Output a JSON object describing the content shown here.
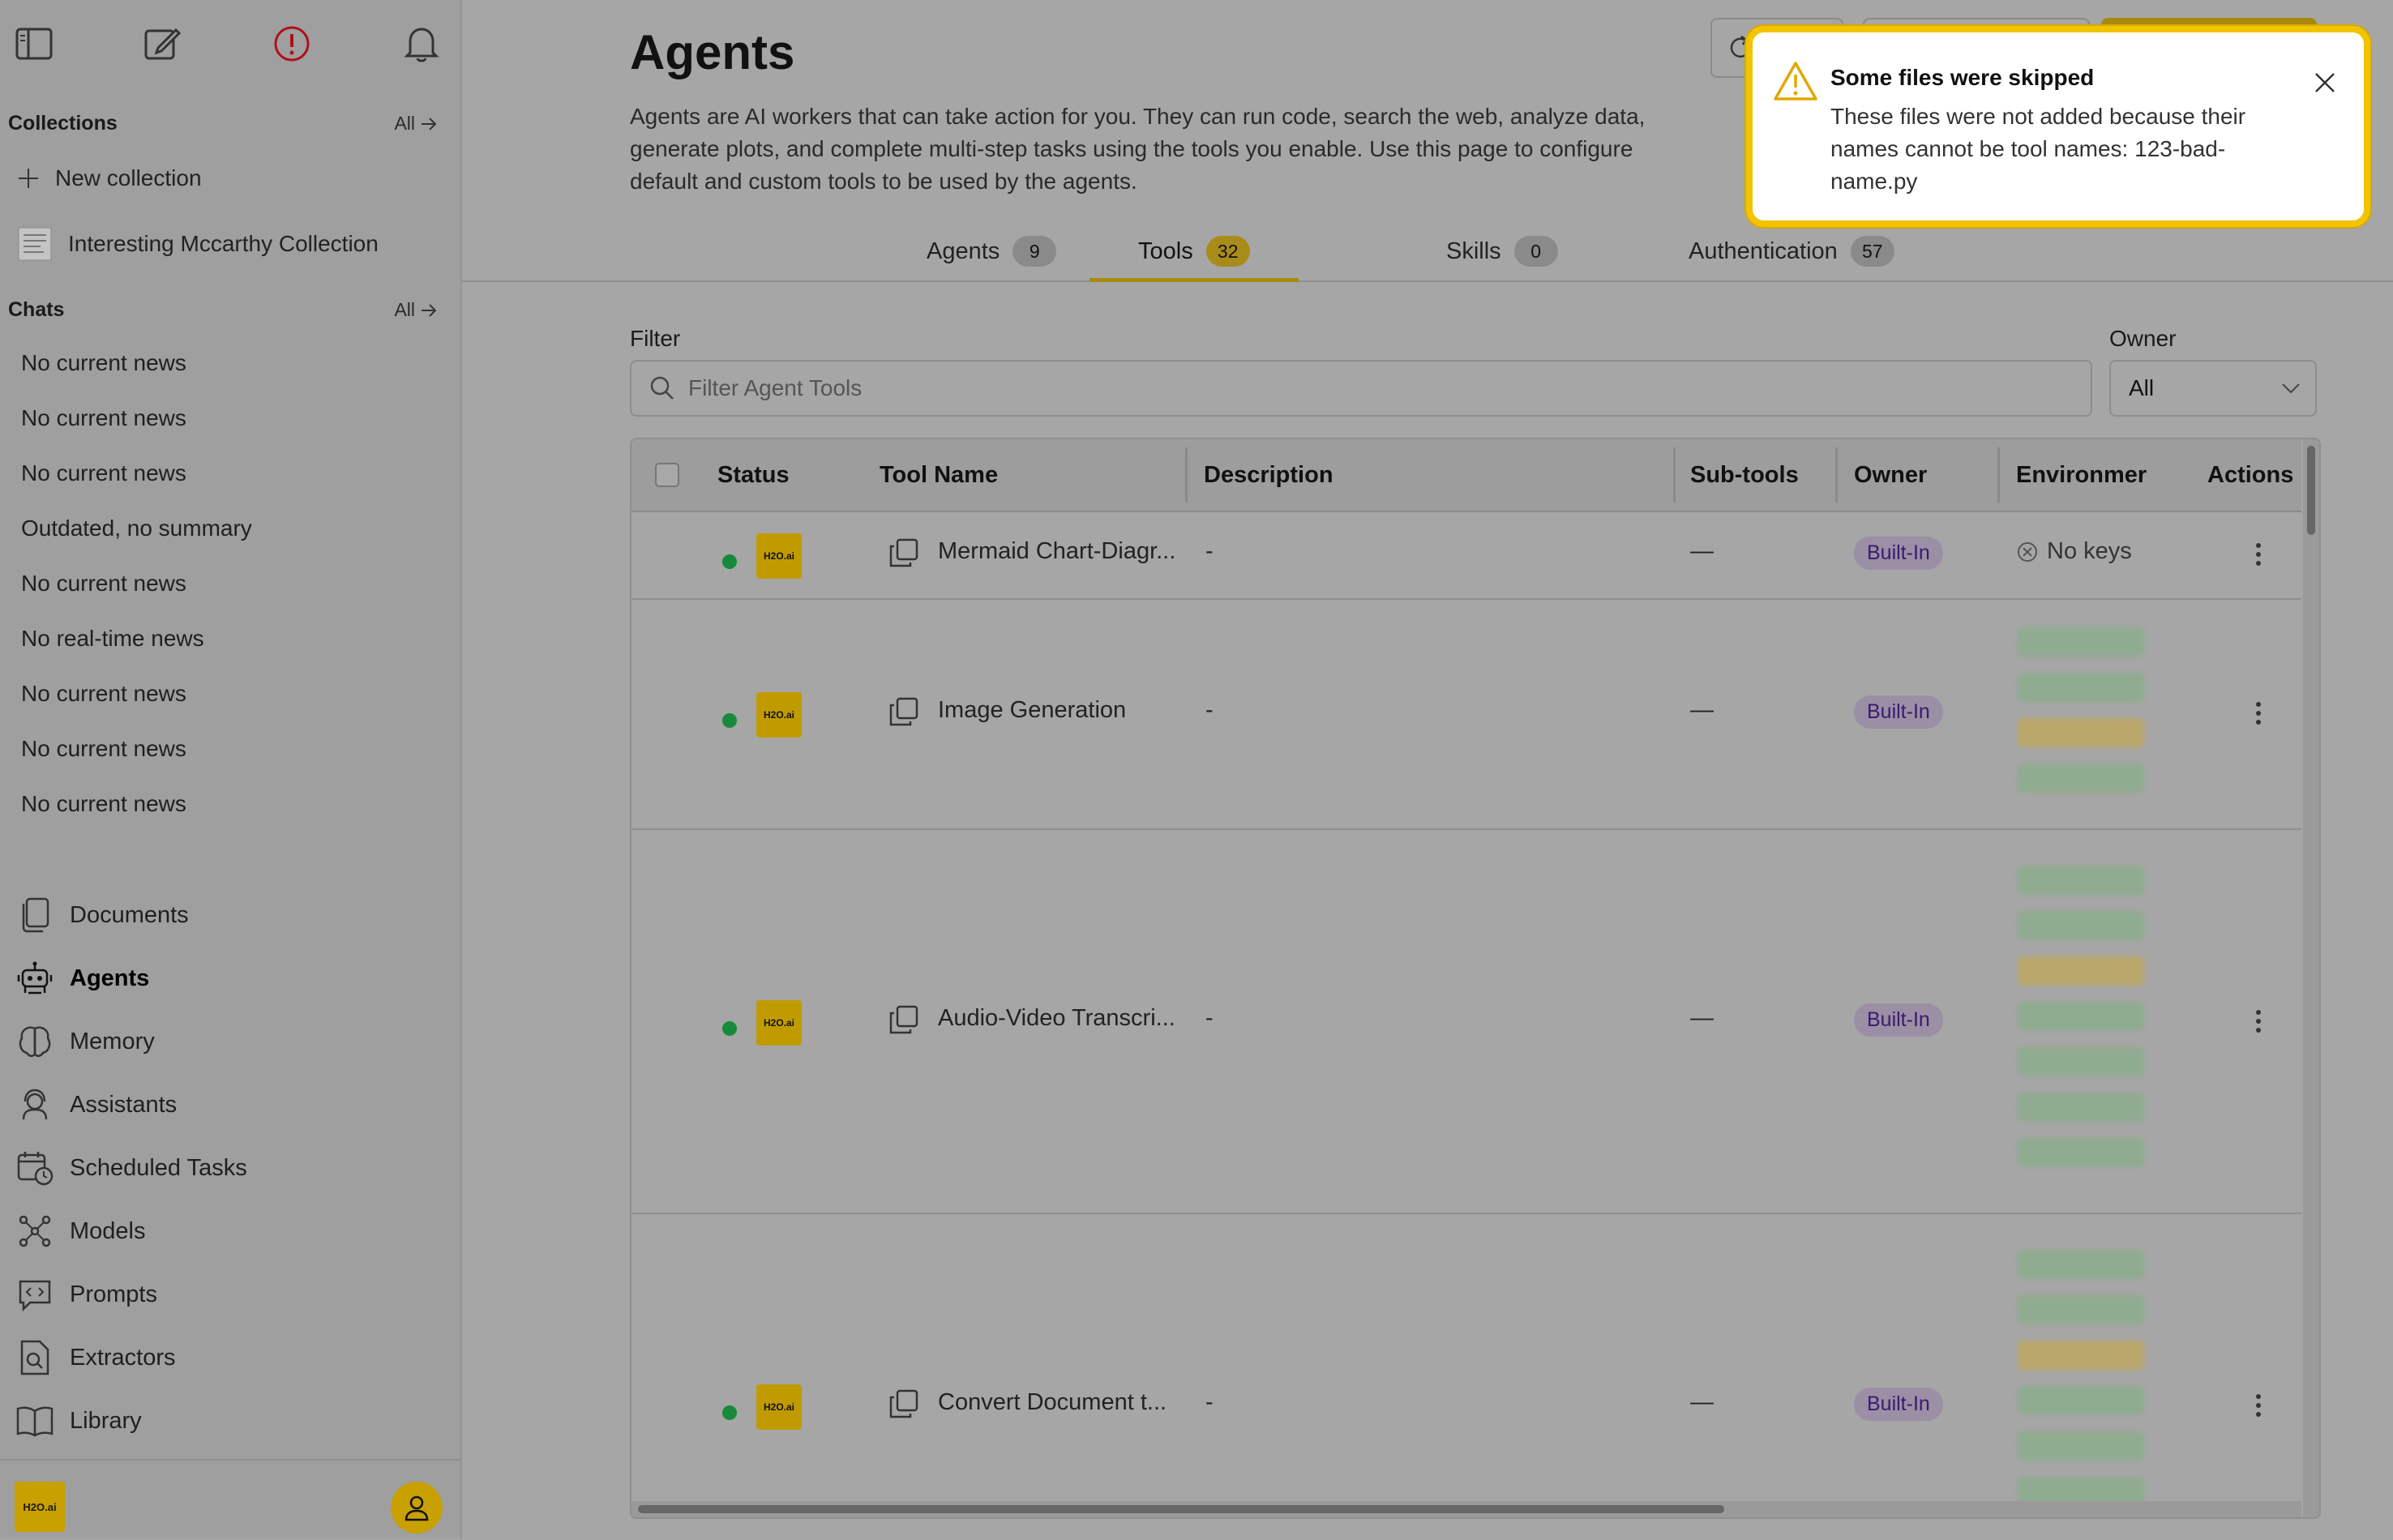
{
  "sidebar": {
    "collections_heading": "Collections",
    "collections_all": "All",
    "new_collection": "New collection",
    "collection_item": "Interesting Mccarthy Collection",
    "chats_heading": "Chats",
    "chats_all": "All",
    "chats": [
      "No current news",
      "No current news",
      "No current news",
      "Outdated, no summary",
      "No current news",
      "No real-time news",
      "No current news",
      "No current news",
      "No current news"
    ],
    "nav": [
      {
        "label": "Documents",
        "icon": "documents-icon"
      },
      {
        "label": "Agents",
        "icon": "robot-icon"
      },
      {
        "label": "Memory",
        "icon": "brain-icon"
      },
      {
        "label": "Assistants",
        "icon": "headset-icon"
      },
      {
        "label": "Scheduled Tasks",
        "icon": "calendar-clock-icon"
      },
      {
        "label": "Models",
        "icon": "network-icon"
      },
      {
        "label": "Prompts",
        "icon": "code-bubble-icon"
      },
      {
        "label": "Extractors",
        "icon": "file-search-icon"
      },
      {
        "label": "Library",
        "icon": "book-icon"
      }
    ],
    "logo_text": "H2O.ai"
  },
  "main": {
    "title": "Agents",
    "description": "Agents are AI workers that can take action for you. They can run code, search the web, analyze data, generate plots, and complete multi-step tasks using the tools you enable. Use this page to configure default and custom tools to be used by the agents.",
    "tabs": [
      {
        "label": "Agents",
        "count": "9"
      },
      {
        "label": "Tools",
        "count": "32",
        "active": true
      },
      {
        "label": "Skills",
        "count": "0"
      },
      {
        "label": "Authentication",
        "count": "57"
      }
    ],
    "filter_label": "Filter",
    "filter_placeholder": "Filter Agent Tools",
    "owner_label": "Owner",
    "owner_value": "All"
  },
  "table": {
    "headers": {
      "status": "Status",
      "tool_name": "Tool Name",
      "description": "Description",
      "subtools": "Sub-tools",
      "owner": "Owner",
      "environment": "Environmer",
      "actions": "Actions"
    },
    "rows": [
      {
        "name": "Mermaid Chart-Diagr...",
        "description": "-",
        "subtools": "—",
        "owner": "Built-In",
        "env": "No keys",
        "logo": "H2O.ai"
      },
      {
        "name": "Image Generation",
        "description": "-",
        "subtools": "—",
        "owner": "Built-In",
        "env": "",
        "logo": "H2O.ai"
      },
      {
        "name": "Audio-Video Transcri...",
        "description": "-",
        "subtools": "—",
        "owner": "Built-In",
        "env": "",
        "logo": "H2O.ai"
      },
      {
        "name": "Convert Document t...",
        "description": "-",
        "subtools": "—",
        "owner": "Built-In",
        "env": "",
        "logo": "H2O.ai"
      }
    ]
  },
  "toast": {
    "title": "Some files were skipped",
    "body": "These files were not added because their names cannot be tool names: 123-bad-name.py"
  },
  "colors": {
    "accent": "#f2c400",
    "status_active": "#178a3c",
    "builtin_text": "#3c1a6e"
  }
}
